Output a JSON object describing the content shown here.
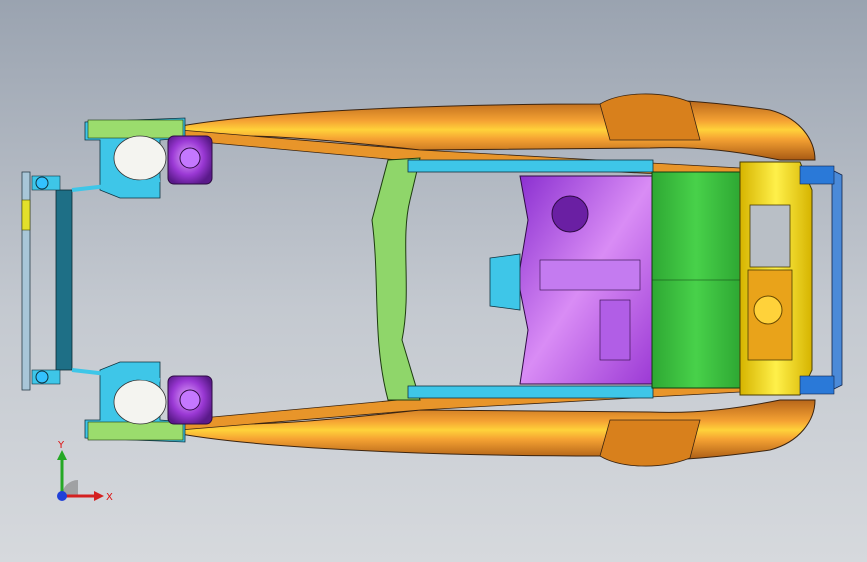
{
  "viewport": {
    "background_top": "#9aa3b0",
    "background_bottom": "#d6d9dd"
  },
  "model": {
    "colors": {
      "rail": "#e08a1e",
      "rail_highlight": "#ffd23a",
      "roof_frame": "#8fd66a",
      "floor": "#b04de8",
      "floor_light": "#d98cf5",
      "panel": "#35c23a",
      "front_end": "#f4e41e",
      "strut_tower": "#9a38d4",
      "cyan_parts": "#3ec6e8",
      "blue_parts": "#2a79d8"
    }
  },
  "triad": {
    "x_label": "X",
    "y_label": "Y",
    "x_color": "#d42020",
    "y_color": "#25a825",
    "z_color": "#2040d8"
  }
}
